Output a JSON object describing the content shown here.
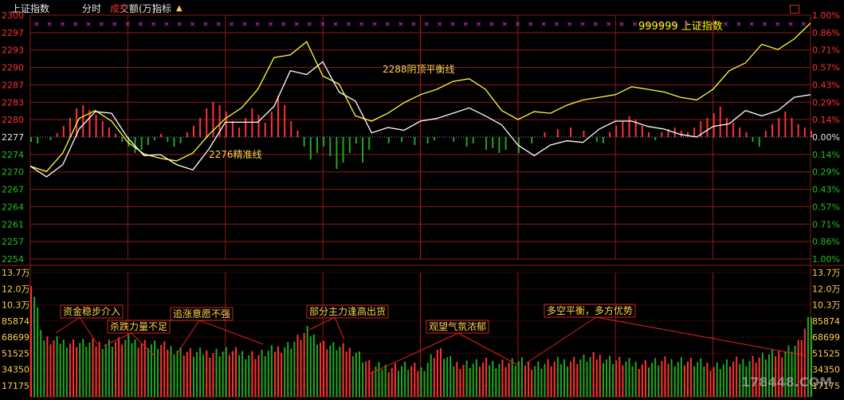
{
  "toolbar": {
    "index_name": "上证指数",
    "tab_time": "分时",
    "tab_cheng": "成",
    "tab_jiao": "交",
    "tab_volume_rest": "额(万)",
    "tab_indicator": "指标",
    "toggle_icon": "up-down-arrows-icon"
  },
  "symbol_label": "999999 上证指数",
  "watermark": "178448.COM",
  "colors": {
    "background": "#000000",
    "grid": "#8b1a1a",
    "price_line": "#ffffff",
    "avg_line": "#ffff33",
    "up_bar": "#ff3232",
    "down_bar": "#1fa81f",
    "marker": "#e040e0",
    "annotation": "#ffd24a",
    "annotation_border": "#d02020",
    "pct_pos": "#ff3030",
    "pct_neg": "#20c020"
  },
  "chart_data": {
    "type": "line",
    "price_ylim": [
      2254,
      2300
    ],
    "price_ticks": [
      "2300",
      "2297",
      "2293",
      "2290",
      "2287",
      "2283",
      "2280",
      "2277",
      "2274",
      "2270",
      "2267",
      "2264",
      "2261",
      "2257",
      "2254"
    ],
    "pct_ticks": [
      "1.00%",
      "0.86%",
      "0.71%",
      "0.57%",
      "0.43%",
      "0.29%",
      "0.14%",
      "0.00%",
      "0.14%",
      "0.29%",
      "0.43%",
      "0.57%",
      "0.71%",
      "0.86%",
      "1.00%"
    ],
    "base_price": 2277,
    "series": [
      {
        "key": "price",
        "x": [
          0,
          5,
          10,
          15,
          20,
          25,
          30,
          35,
          40,
          45,
          50,
          55,
          60,
          65,
          70,
          75,
          80,
          85,
          90,
          95,
          100,
          105,
          110,
          115,
          120,
          125,
          130,
          135,
          140,
          145,
          150,
          155,
          160,
          165,
          170,
          175,
          180,
          185,
          190,
          195,
          200,
          205,
          210,
          215,
          220,
          225,
          230,
          235,
          240
        ],
        "values": [
          2271.5,
          2269.5,
          2271.8,
          2278.5,
          2281.8,
          2281.5,
          2276.8,
          2273.5,
          2273.7,
          2271.8,
          2270.8,
          2274.8,
          2279.8,
          2279.8,
          2279.8,
          2282.8,
          2289.5,
          2288.8,
          2291.2,
          2285.5,
          2283.8,
          2277.8,
          2278.8,
          2278.3,
          2280.0,
          2280.5,
          2281.5,
          2282.5,
          2281.0,
          2279.3,
          2275.5,
          2273.5,
          2275.5,
          2276.3,
          2276.0,
          2278.5,
          2280.0,
          2280.0,
          2279.0,
          2278.5,
          2277.5,
          2277.0,
          2279.0,
          2279.5,
          2282.0,
          2281.0,
          2282.0,
          2284.5,
          2285.0
        ]
      },
      {
        "key": "avg",
        "x": [
          0,
          5,
          10,
          15,
          20,
          25,
          30,
          35,
          40,
          45,
          50,
          55,
          60,
          65,
          70,
          75,
          80,
          85,
          90,
          95,
          100,
          105,
          110,
          115,
          120,
          125,
          130,
          135,
          140,
          145,
          150,
          155,
          160,
          165,
          170,
          175,
          180,
          185,
          190,
          195,
          200,
          205,
          210,
          215,
          220,
          225,
          230,
          235,
          240
        ],
        "values": [
          2271.5,
          2270.5,
          2274.0,
          2280.5,
          2282.0,
          2280.0,
          2276.0,
          2273.8,
          2273.0,
          2272.5,
          2274.0,
          2277.5,
          2280.5,
          2282.5,
          2286.0,
          2292.0,
          2292.5,
          2295.0,
          2288.5,
          2287.0,
          2281.0,
          2280.0,
          2281.5,
          2283.5,
          2285.0,
          2286.0,
          2287.5,
          2288.0,
          2286.0,
          2282.0,
          2280.3,
          2281.8,
          2281.5,
          2283.0,
          2284.0,
          2284.5,
          2285.0,
          2286.5,
          2286.0,
          2285.5,
          2284.5,
          2284.0,
          2286.0,
          2289.5,
          2291.0,
          2294.5,
          2293.5,
          2295.5,
          2298.5
        ]
      }
    ],
    "volume": {
      "ylim": [
        0,
        137000
      ],
      "ticks": [
        "13.7万",
        "12.0万",
        "10.3万",
        "85874",
        "68699",
        "51525",
        "34350",
        "17175"
      ],
      "count": 241,
      "shape_points": [
        [
          0,
          128
        ],
        [
          4,
          62
        ],
        [
          20,
          58
        ],
        [
          30,
          62
        ],
        [
          40,
          56
        ],
        [
          50,
          48
        ],
        [
          60,
          50
        ],
        [
          70,
          46
        ],
        [
          80,
          58
        ],
        [
          85,
          72
        ],
        [
          90,
          58
        ],
        [
          100,
          50
        ],
        [
          105,
          32
        ],
        [
          115,
          34
        ],
        [
          120,
          30
        ],
        [
          125,
          52
        ],
        [
          130,
          36
        ],
        [
          150,
          38
        ],
        [
          155,
          35
        ],
        [
          175,
          44
        ],
        [
          185,
          36
        ],
        [
          200,
          40
        ],
        [
          210,
          34
        ],
        [
          220,
          40
        ],
        [
          230,
          48
        ],
        [
          236,
          58
        ],
        [
          240,
          90
        ]
      ]
    },
    "bars_signed": [
      [
        0,
        -1.5
      ],
      [
        2,
        -2
      ],
      [
        6,
        -1
      ],
      [
        8,
        1.2
      ],
      [
        10,
        3.5
      ],
      [
        12,
        6
      ],
      [
        14,
        9
      ],
      [
        16,
        10
      ],
      [
        18,
        8.5
      ],
      [
        20,
        7
      ],
      [
        22,
        5
      ],
      [
        24,
        3
      ],
      [
        26,
        1
      ],
      [
        28,
        -1.5
      ],
      [
        30,
        -3
      ],
      [
        32,
        -5
      ],
      [
        34,
        -4
      ],
      [
        36,
        -2.5
      ],
      [
        38,
        -1
      ],
      [
        40,
        1
      ],
      [
        42,
        -1.5
      ],
      [
        44,
        -3
      ],
      [
        46,
        -2
      ],
      [
        48,
        1.5
      ],
      [
        50,
        3.5
      ],
      [
        52,
        6
      ],
      [
        54,
        9
      ],
      [
        56,
        11
      ],
      [
        58,
        10
      ],
      [
        60,
        8
      ],
      [
        62,
        5
      ],
      [
        64,
        3
      ],
      [
        66,
        6
      ],
      [
        68,
        9
      ],
      [
        70,
        7
      ],
      [
        72,
        4.5
      ],
      [
        74,
        8
      ],
      [
        76,
        13
      ],
      [
        78,
        10
      ],
      [
        80,
        5
      ],
      [
        82,
        2
      ],
      [
        84,
        -3
      ],
      [
        86,
        -7
      ],
      [
        88,
        -5
      ],
      [
        90,
        -3
      ],
      [
        92,
        -6
      ],
      [
        94,
        -10
      ],
      [
        96,
        -8
      ],
      [
        98,
        -5
      ],
      [
        100,
        -2
      ],
      [
        102,
        -8
      ],
      [
        104,
        -4
      ],
      [
        110,
        -2
      ],
      [
        114,
        -1.5
      ],
      [
        118,
        -2.5
      ],
      [
        122,
        -2
      ],
      [
        124,
        -1
      ],
      [
        130,
        -1.5
      ],
      [
        134,
        -3
      ],
      [
        136,
        -2
      ],
      [
        140,
        -4
      ],
      [
        142,
        -3.5
      ],
      [
        144,
        -5
      ],
      [
        146,
        -4
      ],
      [
        150,
        -5
      ],
      [
        154,
        -2
      ],
      [
        158,
        1.5
      ],
      [
        162,
        2.5
      ],
      [
        166,
        3
      ],
      [
        170,
        2
      ],
      [
        174,
        -1.5
      ],
      [
        176,
        -2
      ],
      [
        178,
        1.5
      ],
      [
        180,
        3.5
      ],
      [
        182,
        5
      ],
      [
        184,
        6.5
      ],
      [
        186,
        5.5
      ],
      [
        188,
        3.5
      ],
      [
        190,
        1.5
      ],
      [
        192,
        -1
      ],
      [
        194,
        1.5
      ],
      [
        196,
        2.5
      ],
      [
        198,
        3
      ],
      [
        200,
        2
      ],
      [
        202,
        1.5
      ],
      [
        204,
        3
      ],
      [
        206,
        5
      ],
      [
        208,
        6
      ],
      [
        210,
        7.5
      ],
      [
        212,
        9.5
      ],
      [
        214,
        6
      ],
      [
        216,
        4.5
      ],
      [
        218,
        3
      ],
      [
        220,
        1.5
      ],
      [
        222,
        -1.5
      ],
      [
        224,
        -3
      ],
      [
        226,
        2
      ],
      [
        228,
        4
      ],
      [
        230,
        6
      ],
      [
        232,
        8
      ],
      [
        234,
        6
      ],
      [
        236,
        4
      ],
      [
        238,
        3
      ],
      [
        240,
        2
      ]
    ],
    "annotations": [
      {
        "text": "2288阴顶平衡线",
        "panel": "price"
      },
      {
        "text": "2276精准线",
        "panel": "price"
      },
      {
        "text": "资金稳步介入",
        "panel": "volume"
      },
      {
        "text": "杀跌力量不足",
        "panel": "volume"
      },
      {
        "text": "追涨意愿不强",
        "panel": "volume"
      },
      {
        "text": "部分主力逢高出货",
        "panel": "volume"
      },
      {
        "text": "观望气氛浓郁",
        "panel": "volume"
      },
      {
        "text": "多空平衡，多方优势",
        "panel": "volume"
      }
    ]
  }
}
